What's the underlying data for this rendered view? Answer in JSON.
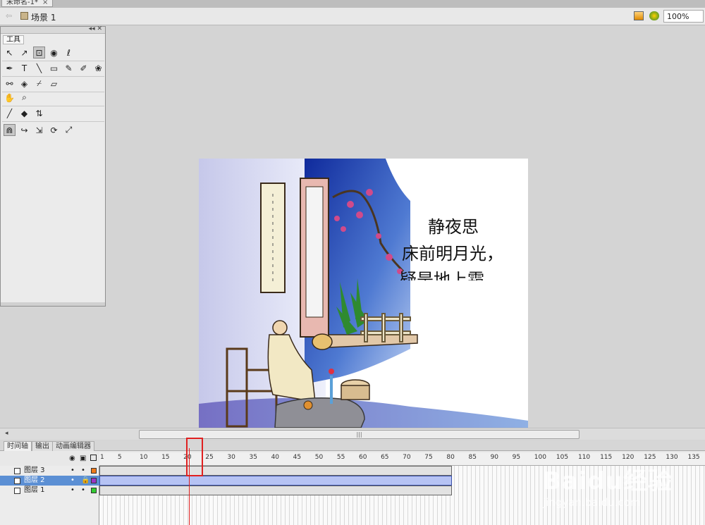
{
  "document": {
    "tab_title": "未命名-1*",
    "tab_close": "×"
  },
  "editbar": {
    "back_glyph": "⇦",
    "scene_label": "场景 1",
    "zoom_value": "100%"
  },
  "tools_panel": {
    "title": "工具",
    "collapse_glyph": "◂◂ ✕",
    "rows": [
      [
        "selection-arrow-icon",
        "subselection-arrow-icon",
        "free-transform-icon",
        "3d-rotation-icon",
        "lasso-icon"
      ],
      [
        "pen-icon",
        "text-icon",
        "line-icon",
        "rectangle-icon",
        "pencil-icon",
        "brush-icon",
        "deco-icon"
      ],
      [
        "bone-icon",
        "paint-bucket-icon",
        "eyedropper-icon",
        "eraser-icon"
      ],
      [
        "hand-icon",
        "zoom-icon"
      ],
      [
        "stroke-color-icon",
        "fill-color-icon",
        "swap-colors-icon"
      ],
      [
        "snap-icon",
        "smooth-icon",
        "straighten-icon",
        "rotate-icon",
        "scale-icon"
      ]
    ],
    "glyphs": {
      "selection-arrow-icon": "↖",
      "subselection-arrow-icon": "↗",
      "free-transform-icon": "⊡",
      "3d-rotation-icon": "◉",
      "lasso-icon": "ℓ",
      "pen-icon": "✒",
      "text-icon": "T",
      "line-icon": "╲",
      "rectangle-icon": "▭",
      "pencil-icon": "✎",
      "brush-icon": "✐",
      "deco-icon": "❀",
      "bone-icon": "⚯",
      "paint-bucket-icon": "◈",
      "eyedropper-icon": "⌿",
      "eraser-icon": "▱",
      "hand-icon": "✋",
      "zoom-icon": "⌕",
      "stroke-color-icon": "╱",
      "fill-color-icon": "◆",
      "swap-colors-icon": "⇅",
      "snap-icon": "⋒",
      "smooth-icon": "↪",
      "straighten-icon": "⇲",
      "rotate-icon": "⟳",
      "scale-icon": "⤢"
    }
  },
  "stage": {
    "poem_title": "静夜思",
    "poem_line1": "床前明月光，",
    "poem_line2": "疑是地上霜"
  },
  "scrollbar": {
    "thumb_label": "|||",
    "left_arrow": "◂"
  },
  "timeline": {
    "tabs": [
      "时间轴",
      "输出",
      "动画编辑器"
    ],
    "ruler_ticks": [
      "1",
      "5",
      "10",
      "15",
      "20",
      "25",
      "30",
      "35",
      "40",
      "45",
      "50",
      "55",
      "60",
      "65",
      "70",
      "75",
      "80",
      "85",
      "90",
      "95",
      "100",
      "105",
      "110",
      "115",
      "120",
      "125",
      "130",
      "135"
    ],
    "layers": [
      {
        "name": "图层 3",
        "color": "#f07a1a",
        "selected": false
      },
      {
        "name": "图层 2",
        "color": "#9b35c8",
        "selected": true
      },
      {
        "name": "图层 1",
        "color": "#33cc33",
        "selected": false
      }
    ],
    "header_icons": [
      "eye-icon",
      "lock-icon",
      "outline-icon"
    ],
    "current_frame": 22
  },
  "watermark": {
    "brand": "Baidu经验",
    "url": "jingyan.baidu.com"
  }
}
